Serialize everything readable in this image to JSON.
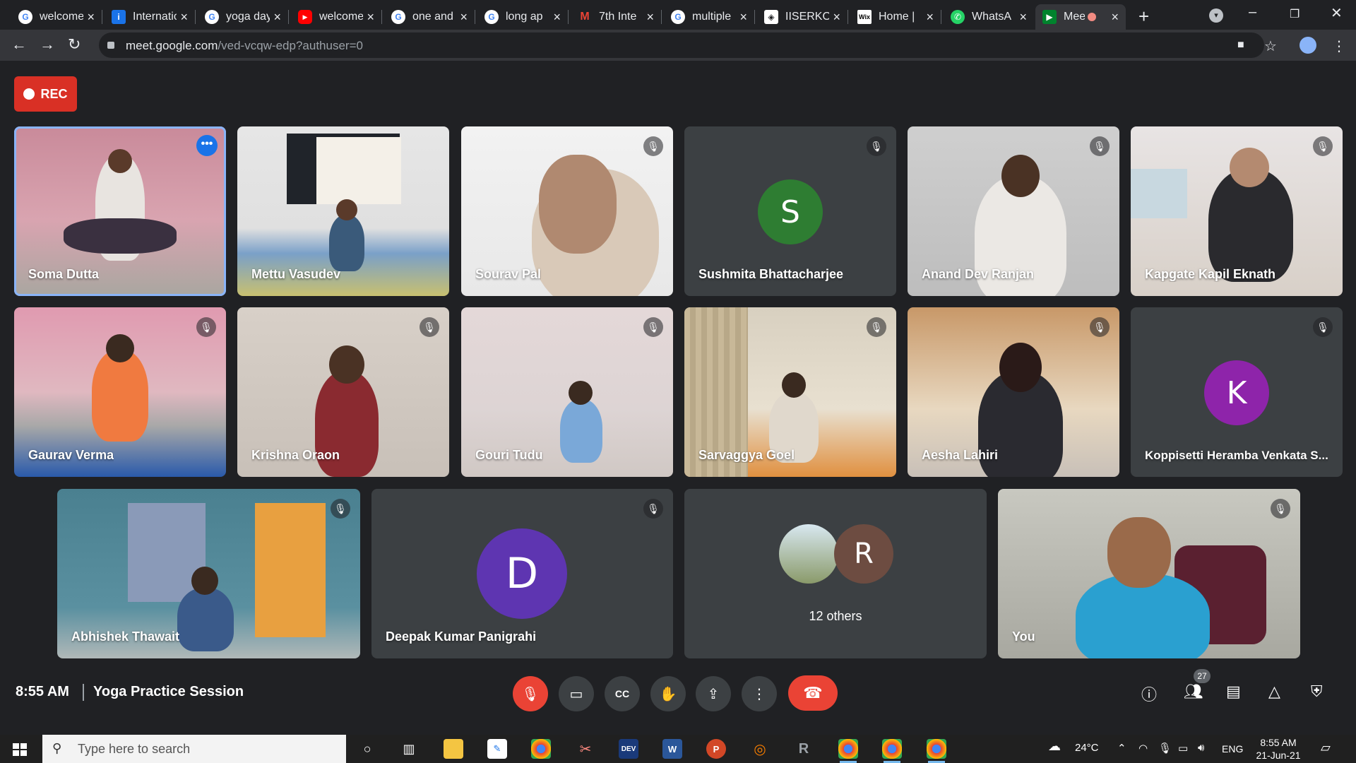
{
  "browser": {
    "tabs": [
      {
        "label": "welcome",
        "icon": "google-icon",
        "color": "#4285f4"
      },
      {
        "label": "International",
        "icon": "site-icon",
        "color": "#1a73e8"
      },
      {
        "label": "yoga day",
        "icon": "google-icon",
        "color": "#4285f4"
      },
      {
        "label": "welcome",
        "icon": "youtube-icon",
        "color": "#ff0000"
      },
      {
        "label": "one and",
        "icon": "google-icon",
        "color": "#4285f4"
      },
      {
        "label": "long ap",
        "icon": "google-icon",
        "color": "#4285f4"
      },
      {
        "label": "7th Inte",
        "icon": "gmail-icon",
        "color": "#ea4335"
      },
      {
        "label": "multiple",
        "icon": "google-icon",
        "color": "#4285f4"
      },
      {
        "label": "IISERKO",
        "icon": "site-icon",
        "color": "#8ab4f8"
      },
      {
        "label": "Home |",
        "icon": "wix-icon",
        "color": "#000000"
      },
      {
        "label": "WhatsA",
        "icon": "whatsapp-icon",
        "color": "#25d366"
      },
      {
        "label": "Mee",
        "icon": "meet-icon",
        "color": "#00832d",
        "active": true
      }
    ],
    "url_host": "meet.google.com",
    "url_path": "/ved-vcqw-edp?authuser=0"
  },
  "rec_label": "REC",
  "tiles": [
    {
      "name": "Soma Dutta",
      "kind": "video",
      "active": true
    },
    {
      "name": "Mettu Vasudev",
      "kind": "video"
    },
    {
      "name": "Sourav Pal",
      "kind": "video",
      "muted": true
    },
    {
      "name": "Sushmita Bhattacharjee",
      "kind": "avatar",
      "initial": "S",
      "avatar_color": "#2e7d32",
      "muted": true
    },
    {
      "name": "Anand Dev Ranjan",
      "kind": "video",
      "muted": true
    },
    {
      "name": "Kapgate Kapil Eknath",
      "kind": "video",
      "muted": true
    },
    {
      "name": "Gaurav Verma",
      "kind": "video",
      "muted": true
    },
    {
      "name": "Krishna Oraon",
      "kind": "video",
      "muted": true
    },
    {
      "name": "Gouri Tudu",
      "kind": "video",
      "muted": true
    },
    {
      "name": "Sarvaggya Goel",
      "kind": "video",
      "muted": true
    },
    {
      "name": "Aesha Lahiri",
      "kind": "video",
      "muted": true
    },
    {
      "name": "Koppisetti Heramba Venkata S...",
      "kind": "avatar",
      "initial": "K",
      "avatar_color": "#8e24aa",
      "muted": true
    },
    {
      "name": "Abhishek Thawait",
      "kind": "video",
      "muted": true
    },
    {
      "name": "Deepak Kumar Panigrahi",
      "kind": "avatar",
      "initial": "D",
      "avatar_color": "#5e35b1",
      "muted": true
    },
    {
      "name": "12 others",
      "kind": "others",
      "initial": "R",
      "avatar_color": "#6d4c41"
    },
    {
      "name": "You",
      "kind": "video",
      "muted": true
    }
  ],
  "bottom_bar": {
    "time": "8:55 AM",
    "meeting_title": "Yoga Practice Session",
    "participant_count": "27"
  },
  "taskbar": {
    "search_placeholder": "Type here to search",
    "weather": "24°C",
    "language": "ENG",
    "time": "8:55 AM",
    "date": "21-Jun-21"
  }
}
